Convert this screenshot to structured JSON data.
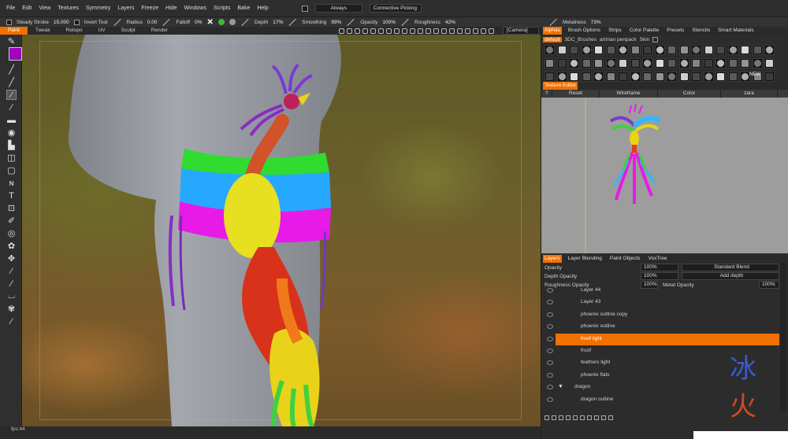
{
  "menu": [
    "File",
    "Edit",
    "View",
    "Textures",
    "Symmetry",
    "Layers",
    "Freeze",
    "Hide",
    "Windows",
    "Scripts",
    "Bake",
    "Help"
  ],
  "menu_extras": {
    "always": "Always",
    "connective": "Connective Picking"
  },
  "tool_settings": {
    "steady_stroke_label": "Steady Stroke",
    "steady_stroke_value": "15.000",
    "invert_tool": "Invert Tool",
    "radius_label": "Radius",
    "radius_value": "0.00",
    "falloff_label": "Falloff",
    "falloff_value": "0%",
    "depth_label": "Depth",
    "depth_value": "17%",
    "smoothing_label": "Smoothing",
    "smoothing_value": "99%",
    "opacity_label": "Opacity",
    "opacity_value": "100%",
    "roughness_label": "Roughness",
    "roughness_value": "42%",
    "metalness_label": "Metalness",
    "metalness_value": "73%"
  },
  "rooms": [
    "Paint",
    "Tweak",
    "Retopo",
    "UV",
    "Sculpt",
    "Render"
  ],
  "active_room": "Paint",
  "camera_combo": "[Camera]",
  "status": {
    "fps": "fps:44"
  },
  "panel_tabs": [
    "Alphas",
    "Brush Options",
    "Strips",
    "Color Palette",
    "Presets",
    "Stencils",
    "Smart Materials"
  ],
  "active_panel_tab": "Alphas",
  "alphas_path": [
    "default",
    "3DC_Brushes",
    "artman penpack",
    "Skin"
  ],
  "alphas_new": "NEW",
  "texture_editor": {
    "title": "Texture Editor",
    "question": "?",
    "reset": "Reset",
    "wireframe": "Wireframe",
    "color": "Color",
    "object": "zara"
  },
  "layers_tabs": [
    "Layers",
    "Layer Blending",
    "Paint Objects",
    "VoxTree"
  ],
  "active_layers_tab": "Layers",
  "layer_props": {
    "opacity_label": "Opacity",
    "opacity_value": "100%",
    "blend_mode": "Standard Blend",
    "depth_opacity_label": "Depth Opacity",
    "depth_opacity_value": "100%",
    "depth_mode": "Add depth",
    "roughness_opacity_label": "Roughness Opacity",
    "roughness_opacity_value": "100%",
    "metal_opacity_label": "Metal Opacity",
    "metal_opacity_value": "100%"
  },
  "layers": [
    {
      "name": "Layer 44",
      "selected": false
    },
    {
      "name": "Layer 43",
      "selected": false
    },
    {
      "name": "phoenix  outline copy",
      "selected": false
    },
    {
      "name": "phoenix  outline",
      "selected": false
    },
    {
      "name": "froof  light",
      "selected": true
    },
    {
      "name": "froof",
      "selected": false
    },
    {
      "name": "feathers  light",
      "selected": false
    },
    {
      "name": "phoenix  flats",
      "selected": false
    },
    {
      "name": "dragon",
      "selected": false
    },
    {
      "name": "dragon  outline",
      "selected": false
    }
  ],
  "colors": {
    "accent": "#f07000",
    "active_color": "#a000c0",
    "panel_bg": "#2c2c2c"
  },
  "watermark_icon": "fire-ice-logo"
}
